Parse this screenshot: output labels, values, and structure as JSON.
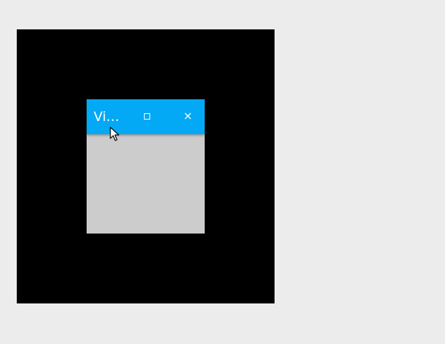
{
  "window": {
    "title": "Vi…",
    "maximize_icon": "maximize-icon",
    "close_label": "×"
  },
  "colors": {
    "desktop": "#ececec",
    "canvas": "#000000",
    "titlebar": "#03a9f4",
    "window_body": "#cccccc"
  },
  "cursor": {
    "icon": "mouse-pointer-icon"
  }
}
